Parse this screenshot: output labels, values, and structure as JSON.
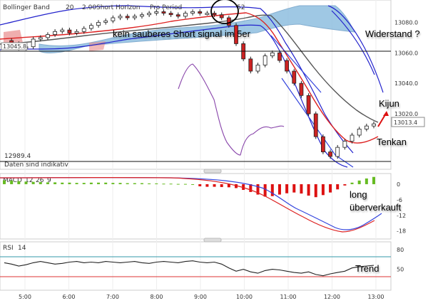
{
  "panels": {
    "price": {
      "indicator_labels": [
        "Bollinger Band",
        "20",
        "2.00",
        "Short Horizon",
        "Pro Period",
        "52"
      ],
      "footer_note": "Daten sind indikativ",
      "low_marker": "12989.4",
      "left_price_label": "13045.8",
      "last_price": "13013.4"
    },
    "macd": {
      "label": "MACD",
      "params": [
        "12",
        "26",
        "9"
      ]
    },
    "rsi": {
      "label": "RSI",
      "param": "14"
    }
  },
  "annotations": {
    "short_signal": "kein sauberes Short signal im 5er",
    "widerstand": "Widerstand ?",
    "kijun": "Kijun",
    "tenkan": "Tenkan",
    "long": "long",
    "ueberverkauft": "überverkauft",
    "trend": "Trend"
  },
  "colors": {
    "bollinger": "#2222cc",
    "cloud": "#8fbfe0",
    "kijun": "#555555",
    "tenkan": "#dd2222",
    "purple": "#8844aa",
    "macd_pos": "#66bb22",
    "macd_neg": "#dd1111",
    "candle_up": "#ffffff",
    "candle_down": "#cc2222",
    "rsi_line": "#222222",
    "rsi_upper": "#3399aa",
    "rsi_lower": "#dd3333"
  },
  "chart_data": [
    {
      "type": "candlestick",
      "panel": "price",
      "x_ticks": [
        "5:00",
        "6:00",
        "7:00",
        "8:00",
        "9:00",
        "10:00",
        "11:00",
        "12:00",
        "13:00"
      ],
      "y_ticks": [
        "13080.0",
        "13060.0",
        "13040.0",
        "13020.0"
      ],
      "ylim": [
        12985,
        13090
      ],
      "horizontal_lines": [
        13060,
        12986
      ],
      "series": [
        {
          "values": [
            13068,
            13066,
            13063,
            13064,
            13069,
            13070,
            13072,
            13074,
            13075,
            13073,
            13074,
            13076,
            13078,
            13080,
            13081,
            13083,
            13084,
            13083,
            13084,
            13085,
            13086,
            13087,
            13086,
            13085,
            13084,
            13086,
            13087,
            13086,
            13086,
            13085,
            13083,
            13078,
            13066,
            13056,
            13048,
            13052,
            13058,
            13060,
            13055,
            13048,
            13040,
            13032,
            13020,
            13005,
            12995,
            12992,
            12998,
            13002,
            13006,
            13010,
            13012,
            13013.4
          ]
        }
      ]
    },
    {
      "type": "bar",
      "panel": "macd",
      "y_ticks": [
        "0",
        "-6",
        "-12",
        "-18"
      ],
      "ylim": [
        -20,
        3
      ],
      "series": [
        {
          "values": [
            1.5,
            1.4,
            1.2,
            1.0,
            0.9,
            0.8,
            0.7,
            0.7,
            0.6,
            0.6,
            0.5,
            0.5,
            0.6,
            0.6,
            0.6,
            0.5,
            0.5,
            0.4,
            0.4,
            0.4,
            0.3,
            0.3,
            0.2,
            0.2,
            0.1,
            0.1,
            0.0,
            -0.8,
            -1.0,
            -1.0,
            -1.1,
            -1.2,
            -1.5,
            -2.2,
            -3.0,
            -4.0,
            -4.8,
            -4.6,
            -4.0,
            -3.5,
            -3.2,
            -3.6,
            -4.4,
            -5.0,
            -4.2,
            -3.2,
            -2.0,
            -0.5,
            0.6,
            1.4,
            2.2,
            2.8
          ]
        }
      ]
    },
    {
      "type": "line",
      "panel": "rsi",
      "y_ticks": [
        "80",
        "50"
      ],
      "ylim": [
        20,
        90
      ],
      "reference_lines": [
        80,
        50
      ],
      "series": [
        {
          "values": [
            60,
            58,
            55,
            57,
            60,
            62,
            60,
            58,
            59,
            61,
            62,
            60,
            61,
            60,
            62,
            61,
            60,
            61,
            62,
            60,
            59,
            61,
            62,
            61,
            60,
            62,
            63,
            61,
            60,
            61,
            58,
            52,
            47,
            50,
            46,
            44,
            48,
            50,
            49,
            47,
            45,
            44,
            46,
            42,
            40,
            43,
            45,
            47,
            52,
            54,
            55,
            56
          ]
        }
      ]
    }
  ]
}
